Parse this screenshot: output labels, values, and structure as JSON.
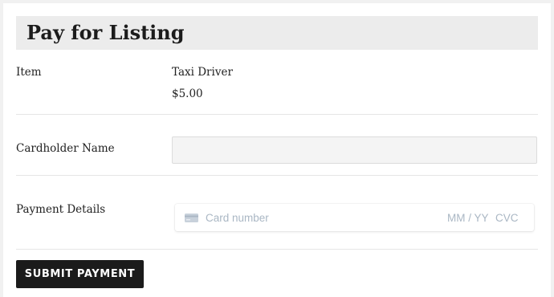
{
  "form": {
    "title": "Pay for Listing",
    "item": {
      "label": "Item",
      "name": "Taxi Driver",
      "price": "$5.00"
    },
    "cardholder": {
      "label": "Cardholder Name",
      "value": "",
      "placeholder": ""
    },
    "payment": {
      "label": "Payment Details",
      "card_number_placeholder": "Card number",
      "expiry_placeholder": "MM / YY",
      "cvc_placeholder": "CVC",
      "card_icon": "credit-card-icon"
    },
    "submit_label": "SUBMIT PAYMENT"
  },
  "colors": {
    "title_bar": "#ececec",
    "button": "#1b1b1b",
    "button_text": "#ffffff",
    "stripe_placeholder": "#aab7c4"
  }
}
